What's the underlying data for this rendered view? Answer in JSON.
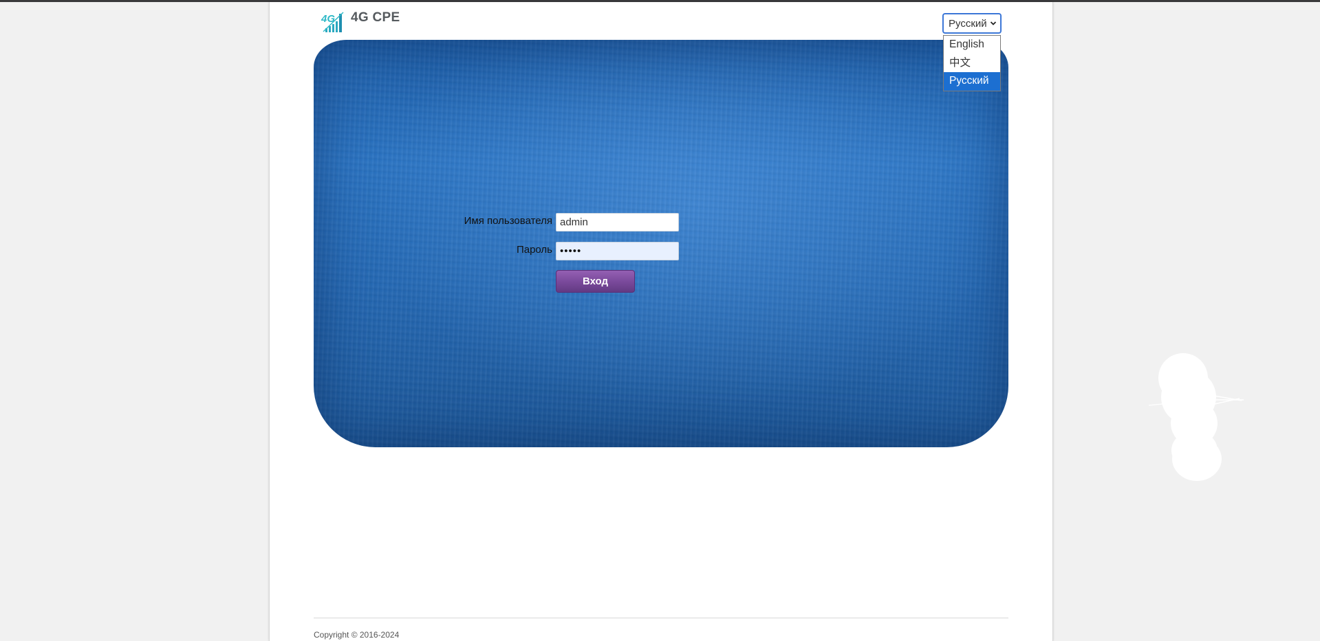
{
  "header": {
    "logo_text": "4G CPE",
    "logo_icon": "4g-signal-logo-icon"
  },
  "language": {
    "selected": "Русский",
    "options": [
      "English",
      "中文",
      "Русский"
    ]
  },
  "login": {
    "username_label": "Имя пользователя",
    "username_value": "admin",
    "password_label": "Пароль",
    "password_value": "•••••",
    "submit_label": "Вход"
  },
  "footer": {
    "copyright": "Copyright © 2016-2024"
  },
  "colors": {
    "accent": "#1c6fd1",
    "button": "#7b4a9c",
    "hero": "#2a73c2"
  }
}
